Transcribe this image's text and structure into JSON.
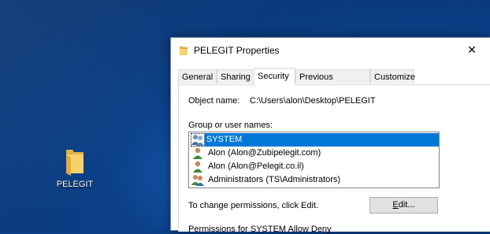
{
  "desktop": {
    "icon_label": "PELEGIT"
  },
  "window": {
    "title": "PELEGIT Properties",
    "close_glyph": "✕"
  },
  "tabs": [
    {
      "label": "General"
    },
    {
      "label": "Sharing"
    },
    {
      "label": "Security",
      "active": true
    },
    {
      "label": "Previous Versions"
    },
    {
      "label": "Customize"
    }
  ],
  "security": {
    "object_name_label": "Object name:",
    "object_name_value": "C:\\Users\\alon\\Desktop\\PELEGIT",
    "group_label": "Group or user names:",
    "users": [
      {
        "name": "SYSTEM",
        "icon": "users-group-icon",
        "selected": true
      },
      {
        "name": "Alon (Alon@Zubipelegit.com)",
        "icon": "user-icon"
      },
      {
        "name": "Alon (Alon@Pelegit.co.il)",
        "icon": "user-icon"
      },
      {
        "name": "Administrators (TS\\Administrators)",
        "icon": "users-group-icon"
      }
    ],
    "change_text": "To change permissions, click Edit.",
    "edit_button_prefix": "",
    "edit_button_mnemonic": "E",
    "edit_button_suffix": "dit...",
    "permissions_cut": "Permissions for SYSTEM                    Allow          Deny"
  }
}
